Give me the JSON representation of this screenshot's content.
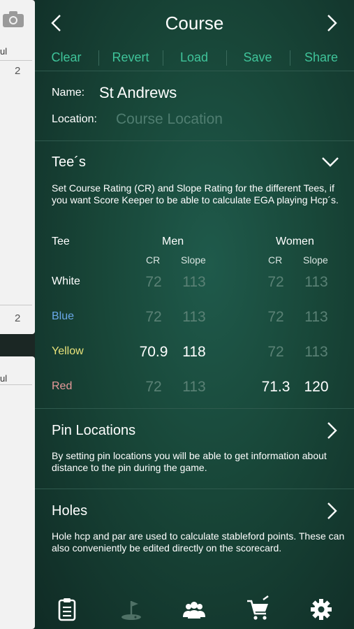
{
  "background_card": {
    "top_label": "ul",
    "top_number": "2",
    "mid_number": "2",
    "bottom_label": "ul"
  },
  "nav": {
    "title": "Course"
  },
  "toolbar": {
    "clear": "Clear",
    "revert": "Revert",
    "load": "Load",
    "save": "Save",
    "share": "Share"
  },
  "course": {
    "name_label": "Name:",
    "name_value": "St Andrews",
    "location_label": "Location:",
    "location_placeholder": "Course Location"
  },
  "tees": {
    "title": "Tee´s",
    "description": "Set Course Rating (CR) and Slope Rating for the different Tees, if you want Score Keeper to be able to calculate EGA playing Hcp´s.",
    "col_tee": "Tee",
    "col_men": "Men",
    "col_women": "Women",
    "cr": "CR",
    "slope": "Slope",
    "rows": [
      {
        "name": "White",
        "color": "#ffffff",
        "men_cr": "72",
        "men_slope": "113",
        "women_cr": "72",
        "women_slope": "113"
      },
      {
        "name": "Blue",
        "color": "#6aa8e8",
        "men_cr": "72",
        "men_slope": "113",
        "women_cr": "72",
        "women_slope": "113"
      },
      {
        "name": "Yellow",
        "color": "#e8e27a",
        "men_cr": "70.9",
        "men_slope": "118",
        "women_cr": "72",
        "women_slope": "113"
      },
      {
        "name": "Red",
        "color": "#e89a9a",
        "men_cr": "72",
        "men_slope": "113",
        "women_cr": "71.3",
        "women_slope": "120"
      }
    ]
  },
  "pins": {
    "title": "Pin Locations",
    "description": "By setting pin locations you will be able to get information about distance to the pin during the game."
  },
  "holes": {
    "title": "Holes",
    "description": "Hole hcp and par are used to calculate stableford points. These can also conveniently be edited directly on the scorecard."
  },
  "tabbar": {
    "icons": [
      "scorecard-icon",
      "course-icon",
      "players-icon",
      "shop-icon",
      "settings-icon"
    ]
  },
  "colors": {
    "accent": "#3fc49a",
    "placeholder": "#5a8175"
  }
}
